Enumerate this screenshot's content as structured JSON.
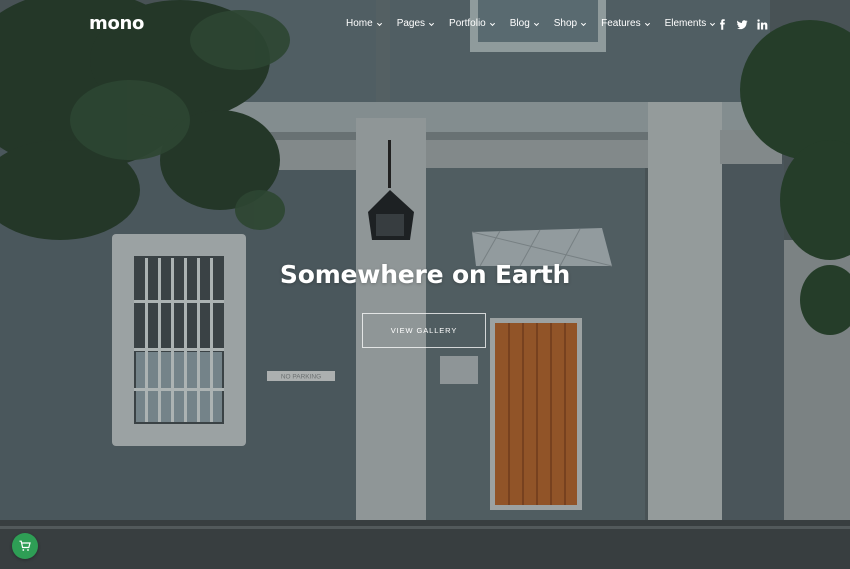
{
  "brand": {
    "logo": "mono"
  },
  "nav": {
    "items": [
      {
        "label": "Home"
      },
      {
        "label": "Pages"
      },
      {
        "label": "Portfolio"
      },
      {
        "label": "Blog"
      },
      {
        "label": "Shop"
      },
      {
        "label": "Features"
      },
      {
        "label": "Elements"
      }
    ],
    "socials": [
      "facebook-icon",
      "twitter-icon",
      "linkedin-icon"
    ]
  },
  "hero": {
    "title": "Somewhere on Earth",
    "cta_label": "VIEW GALLERY",
    "plaque_text": "NO PARKING"
  },
  "cart": {
    "icon": "cart-icon",
    "color": "#2e9e55"
  },
  "colors": {
    "wall": "#56656a",
    "door": "#9c5a2a",
    "trim": "#b8bfc0"
  }
}
